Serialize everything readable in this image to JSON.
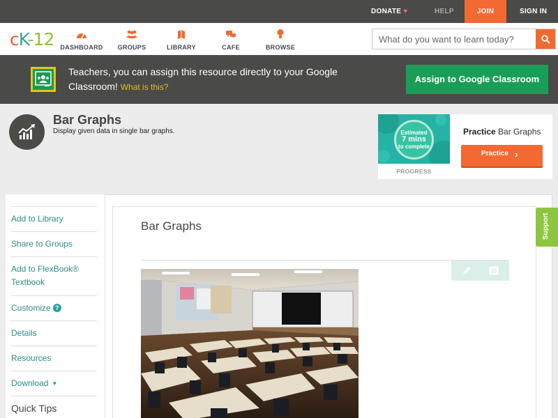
{
  "topbar": {
    "donate": "DONATE",
    "help": "HELP",
    "join": "JOIN",
    "signin": "SIGN IN"
  },
  "logo": {
    "c": "c",
    "k": "K",
    "n": "-12"
  },
  "nav": {
    "items": [
      {
        "label": "DASHBOARD",
        "icon": "dashboard-icon"
      },
      {
        "label": "GROUPS",
        "icon": "groups-icon"
      },
      {
        "label": "LIBRARY",
        "icon": "library-icon"
      },
      {
        "label": "CAFE",
        "icon": "cafe-icon"
      },
      {
        "label": "BROWSE",
        "icon": "browse-icon"
      }
    ],
    "search_placeholder": "What do you want to learn today?"
  },
  "classroom_banner": {
    "text": "Teachers, you can assign this resource directly to your Google Classroom!",
    "what_link": "What is this?",
    "button": "Assign to Google Classroom"
  },
  "resource": {
    "title": "Bar Graphs",
    "subtitle": "Display given data in single bar graphs."
  },
  "practice": {
    "circle_line1": "Estimated",
    "circle_line2": "7 mins",
    "circle_line3": "to complete",
    "progress_label": "PROGRESS",
    "title_bold": "Practice",
    "title_rest": "Bar Graphs",
    "button": "Practice"
  },
  "sidebar": {
    "items": [
      {
        "label": "Add to Library"
      },
      {
        "label": "Share to Groups"
      },
      {
        "label": "Add to FlexBook®"
      },
      {
        "label": "Textbook"
      },
      {
        "label": "Customize"
      },
      {
        "label": "Details"
      },
      {
        "label": "Resources"
      },
      {
        "label": "Download"
      },
      {
        "label": "Quick Tips"
      }
    ],
    "help_badge": "?",
    "caret": "▼"
  },
  "content": {
    "title": "Bar Graphs"
  },
  "support_tab": "Support",
  "colors": {
    "accent_orange": "#f26931",
    "dark_bar": "#4a4a48",
    "google_green": "#1a9e57",
    "teal_link": "#2d8a8a",
    "support_green": "#8cc63f"
  }
}
